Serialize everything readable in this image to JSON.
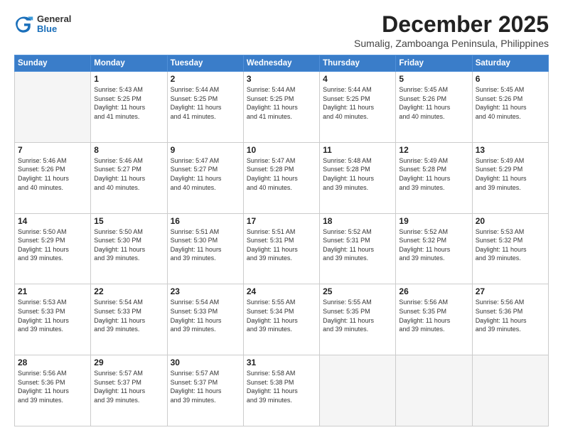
{
  "header": {
    "logo": {
      "general": "General",
      "blue": "Blue"
    },
    "title": "December 2025",
    "location": "Sumalig, Zamboanga Peninsula, Philippines"
  },
  "days_of_week": [
    "Sunday",
    "Monday",
    "Tuesday",
    "Wednesday",
    "Thursday",
    "Friday",
    "Saturday"
  ],
  "weeks": [
    [
      {
        "day": "",
        "info": ""
      },
      {
        "day": "1",
        "info": "Sunrise: 5:43 AM\nSunset: 5:25 PM\nDaylight: 11 hours\nand 41 minutes."
      },
      {
        "day": "2",
        "info": "Sunrise: 5:44 AM\nSunset: 5:25 PM\nDaylight: 11 hours\nand 41 minutes."
      },
      {
        "day": "3",
        "info": "Sunrise: 5:44 AM\nSunset: 5:25 PM\nDaylight: 11 hours\nand 41 minutes."
      },
      {
        "day": "4",
        "info": "Sunrise: 5:44 AM\nSunset: 5:25 PM\nDaylight: 11 hours\nand 40 minutes."
      },
      {
        "day": "5",
        "info": "Sunrise: 5:45 AM\nSunset: 5:26 PM\nDaylight: 11 hours\nand 40 minutes."
      },
      {
        "day": "6",
        "info": "Sunrise: 5:45 AM\nSunset: 5:26 PM\nDaylight: 11 hours\nand 40 minutes."
      }
    ],
    [
      {
        "day": "7",
        "info": "Sunrise: 5:46 AM\nSunset: 5:26 PM\nDaylight: 11 hours\nand 40 minutes."
      },
      {
        "day": "8",
        "info": "Sunrise: 5:46 AM\nSunset: 5:27 PM\nDaylight: 11 hours\nand 40 minutes."
      },
      {
        "day": "9",
        "info": "Sunrise: 5:47 AM\nSunset: 5:27 PM\nDaylight: 11 hours\nand 40 minutes."
      },
      {
        "day": "10",
        "info": "Sunrise: 5:47 AM\nSunset: 5:28 PM\nDaylight: 11 hours\nand 40 minutes."
      },
      {
        "day": "11",
        "info": "Sunrise: 5:48 AM\nSunset: 5:28 PM\nDaylight: 11 hours\nand 39 minutes."
      },
      {
        "day": "12",
        "info": "Sunrise: 5:49 AM\nSunset: 5:28 PM\nDaylight: 11 hours\nand 39 minutes."
      },
      {
        "day": "13",
        "info": "Sunrise: 5:49 AM\nSunset: 5:29 PM\nDaylight: 11 hours\nand 39 minutes."
      }
    ],
    [
      {
        "day": "14",
        "info": "Sunrise: 5:50 AM\nSunset: 5:29 PM\nDaylight: 11 hours\nand 39 minutes."
      },
      {
        "day": "15",
        "info": "Sunrise: 5:50 AM\nSunset: 5:30 PM\nDaylight: 11 hours\nand 39 minutes."
      },
      {
        "day": "16",
        "info": "Sunrise: 5:51 AM\nSunset: 5:30 PM\nDaylight: 11 hours\nand 39 minutes."
      },
      {
        "day": "17",
        "info": "Sunrise: 5:51 AM\nSunset: 5:31 PM\nDaylight: 11 hours\nand 39 minutes."
      },
      {
        "day": "18",
        "info": "Sunrise: 5:52 AM\nSunset: 5:31 PM\nDaylight: 11 hours\nand 39 minutes."
      },
      {
        "day": "19",
        "info": "Sunrise: 5:52 AM\nSunset: 5:32 PM\nDaylight: 11 hours\nand 39 minutes."
      },
      {
        "day": "20",
        "info": "Sunrise: 5:53 AM\nSunset: 5:32 PM\nDaylight: 11 hours\nand 39 minutes."
      }
    ],
    [
      {
        "day": "21",
        "info": "Sunrise: 5:53 AM\nSunset: 5:33 PM\nDaylight: 11 hours\nand 39 minutes."
      },
      {
        "day": "22",
        "info": "Sunrise: 5:54 AM\nSunset: 5:33 PM\nDaylight: 11 hours\nand 39 minutes."
      },
      {
        "day": "23",
        "info": "Sunrise: 5:54 AM\nSunset: 5:33 PM\nDaylight: 11 hours\nand 39 minutes."
      },
      {
        "day": "24",
        "info": "Sunrise: 5:55 AM\nSunset: 5:34 PM\nDaylight: 11 hours\nand 39 minutes."
      },
      {
        "day": "25",
        "info": "Sunrise: 5:55 AM\nSunset: 5:35 PM\nDaylight: 11 hours\nand 39 minutes."
      },
      {
        "day": "26",
        "info": "Sunrise: 5:56 AM\nSunset: 5:35 PM\nDaylight: 11 hours\nand 39 minutes."
      },
      {
        "day": "27",
        "info": "Sunrise: 5:56 AM\nSunset: 5:36 PM\nDaylight: 11 hours\nand 39 minutes."
      }
    ],
    [
      {
        "day": "28",
        "info": "Sunrise: 5:56 AM\nSunset: 5:36 PM\nDaylight: 11 hours\nand 39 minutes."
      },
      {
        "day": "29",
        "info": "Sunrise: 5:57 AM\nSunset: 5:37 PM\nDaylight: 11 hours\nand 39 minutes."
      },
      {
        "day": "30",
        "info": "Sunrise: 5:57 AM\nSunset: 5:37 PM\nDaylight: 11 hours\nand 39 minutes."
      },
      {
        "day": "31",
        "info": "Sunrise: 5:58 AM\nSunset: 5:38 PM\nDaylight: 11 hours\nand 39 minutes."
      },
      {
        "day": "",
        "info": ""
      },
      {
        "day": "",
        "info": ""
      },
      {
        "day": "",
        "info": ""
      }
    ]
  ]
}
